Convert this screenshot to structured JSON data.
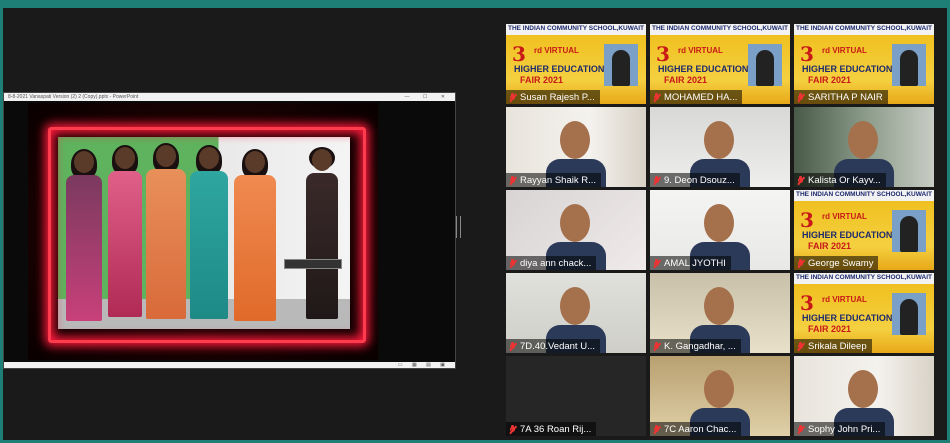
{
  "share": {
    "window_title": "8-8-2021 Vanaspati Version (2) 2 (Copy).pptx - PowerPoint",
    "window_controls": "— ☐ ✕",
    "status_controls": "▭ ▦ ▤ ▣"
  },
  "participants": [
    {
      "name": "Susan Rajesh P...",
      "muted": true,
      "video": "poster"
    },
    {
      "name": "MOHAMED HA...",
      "muted": true,
      "video": "poster"
    },
    {
      "name": "SARITHA P NAIR",
      "muted": true,
      "video": "poster"
    },
    {
      "name": "Rayyan Shaik R...",
      "muted": true,
      "video": "camera"
    },
    {
      "name": "9. Deon Dsouz...",
      "muted": true,
      "video": "camera"
    },
    {
      "name": "Kalista Or Kayv...",
      "muted": true,
      "video": "camera"
    },
    {
      "name": "diya ann chack...",
      "muted": true,
      "video": "camera"
    },
    {
      "name": "AMAL JYOTHI",
      "muted": true,
      "video": "camera"
    },
    {
      "name": "George Swamy",
      "muted": true,
      "video": "poster"
    },
    {
      "name": "7D.40.Vedant U...",
      "muted": true,
      "video": "camera"
    },
    {
      "name": "K. Gangadhar, ...",
      "muted": true,
      "video": "camera",
      "active_speaker": true
    },
    {
      "name": "Srikala Dileep",
      "muted": true,
      "video": "poster"
    },
    {
      "name": "7A 36 Roan Rij...",
      "muted": true,
      "video": "off"
    },
    {
      "name": "7C Aaron Chac...",
      "muted": true,
      "video": "camera"
    },
    {
      "name": "Sophy John Pri...",
      "muted": true,
      "video": "camera"
    }
  ],
  "poster": {
    "school": "THE INDIAN COMMUNITY SCHOOL,KUWAIT",
    "big3": "3",
    "line1": "rd VIRTUAL",
    "line2": "HIGHER EDUCATION",
    "line3": "FAIR 2021"
  },
  "colors": {
    "frame": "#1e7f77",
    "active_outline": "#d6c52e",
    "muted": "#e33"
  }
}
